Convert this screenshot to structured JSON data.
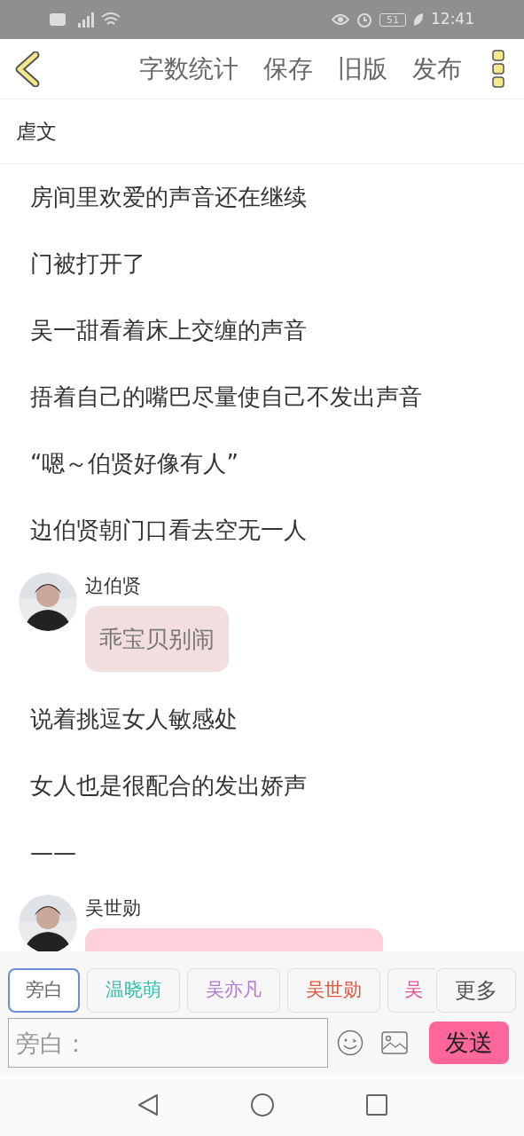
{
  "status_bar": {
    "time": "12:41",
    "battery": "51"
  },
  "toolbar": {
    "actions": [
      "字数统计",
      "保存",
      "旧版",
      "发布"
    ]
  },
  "document": {
    "title": "虐文"
  },
  "content": [
    {
      "kind": "text",
      "text": "房间里欢爱的声音还在继续"
    },
    {
      "kind": "text",
      "text": "门被打开了"
    },
    {
      "kind": "text",
      "text": "吴一甜看着床上交缠的声音"
    },
    {
      "kind": "text",
      "text": "捂着自己的嘴巴尽量使自己不发出声音"
    },
    {
      "kind": "text",
      "text": "“嗯～伯贤好像有人”"
    },
    {
      "kind": "text",
      "text": "边伯贤朝门口看去空无一人"
    },
    {
      "kind": "message",
      "speaker": "边伯贤",
      "text": "乖宝贝别闹",
      "color": "#f2dede"
    },
    {
      "kind": "text",
      "text": "说着挑逗女人敏感处"
    },
    {
      "kind": "text",
      "text": "女人也是很配合的发出娇声"
    },
    {
      "kind": "text",
      "text": "——"
    },
    {
      "kind": "message",
      "speaker": "吴世勋",
      "color": "#ffd1dc"
    }
  ],
  "characters": [
    {
      "name": "旁白",
      "color": "#666666",
      "selected": true
    },
    {
      "name": "温晓萌",
      "color": "#33bfae",
      "selected": false
    },
    {
      "name": "吴亦凡",
      "color": "#b07ad6",
      "selected": false
    },
    {
      "name": "吴世勋",
      "color": "#e0553c",
      "selected": false
    },
    {
      "name": "吴",
      "color": "#e8509a",
      "selected": false
    }
  ],
  "more_button": "更多",
  "composer": {
    "placeholder": "旁白：",
    "send": "发送"
  }
}
